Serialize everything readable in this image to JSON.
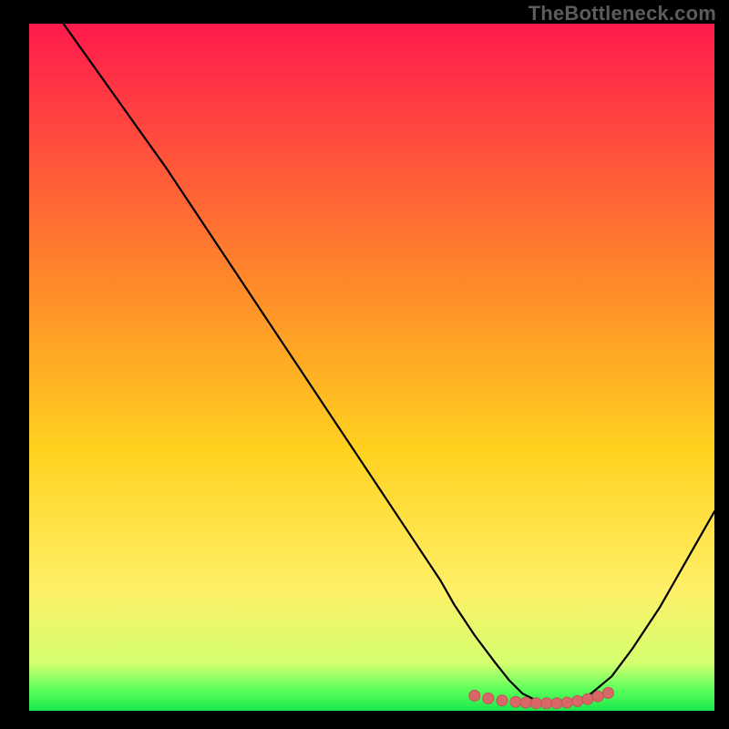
{
  "watermark": "TheBottleneck.com",
  "colors": {
    "frame": "#000000",
    "gradient_top": "#ff1a4d",
    "gradient_mid": "#ffb500",
    "gradient_low": "#ffef66",
    "gradient_green_light": "#8cff6a",
    "gradient_green": "#19e84c",
    "curve_stroke": "#000000",
    "marker_fill": "#d96767",
    "marker_stroke": "#c25555"
  },
  "chart_data": {
    "type": "line",
    "title": "",
    "xlabel": "",
    "ylabel": "",
    "xlim": [
      0,
      100
    ],
    "ylim": [
      0,
      100
    ],
    "grid": false,
    "legend": false,
    "series": [
      {
        "name": "bottleneck-curve",
        "x": [
          5,
          10,
          15,
          20,
          25,
          30,
          35,
          40,
          45,
          50,
          55,
          60,
          62,
          65,
          68,
          70,
          72,
          74,
          76,
          78,
          80,
          82,
          85,
          88,
          92,
          96,
          100
        ],
        "y": [
          100,
          93,
          86,
          79,
          71.5,
          64,
          56.5,
          49,
          41.5,
          34,
          26.5,
          19,
          15.5,
          11,
          7,
          4.5,
          2.5,
          1.5,
          1,
          1,
          1.5,
          2.5,
          5,
          9,
          15,
          22,
          29
        ]
      }
    ],
    "markers": {
      "name": "optimal-range-dots",
      "x": [
        65,
        67,
        69,
        71,
        72.5,
        74,
        75.5,
        77,
        78.5,
        80,
        81.5,
        83,
        84.5
      ],
      "y": [
        2.2,
        1.8,
        1.5,
        1.3,
        1.2,
        1.1,
        1.1,
        1.1,
        1.2,
        1.4,
        1.7,
        2.1,
        2.6
      ]
    }
  }
}
